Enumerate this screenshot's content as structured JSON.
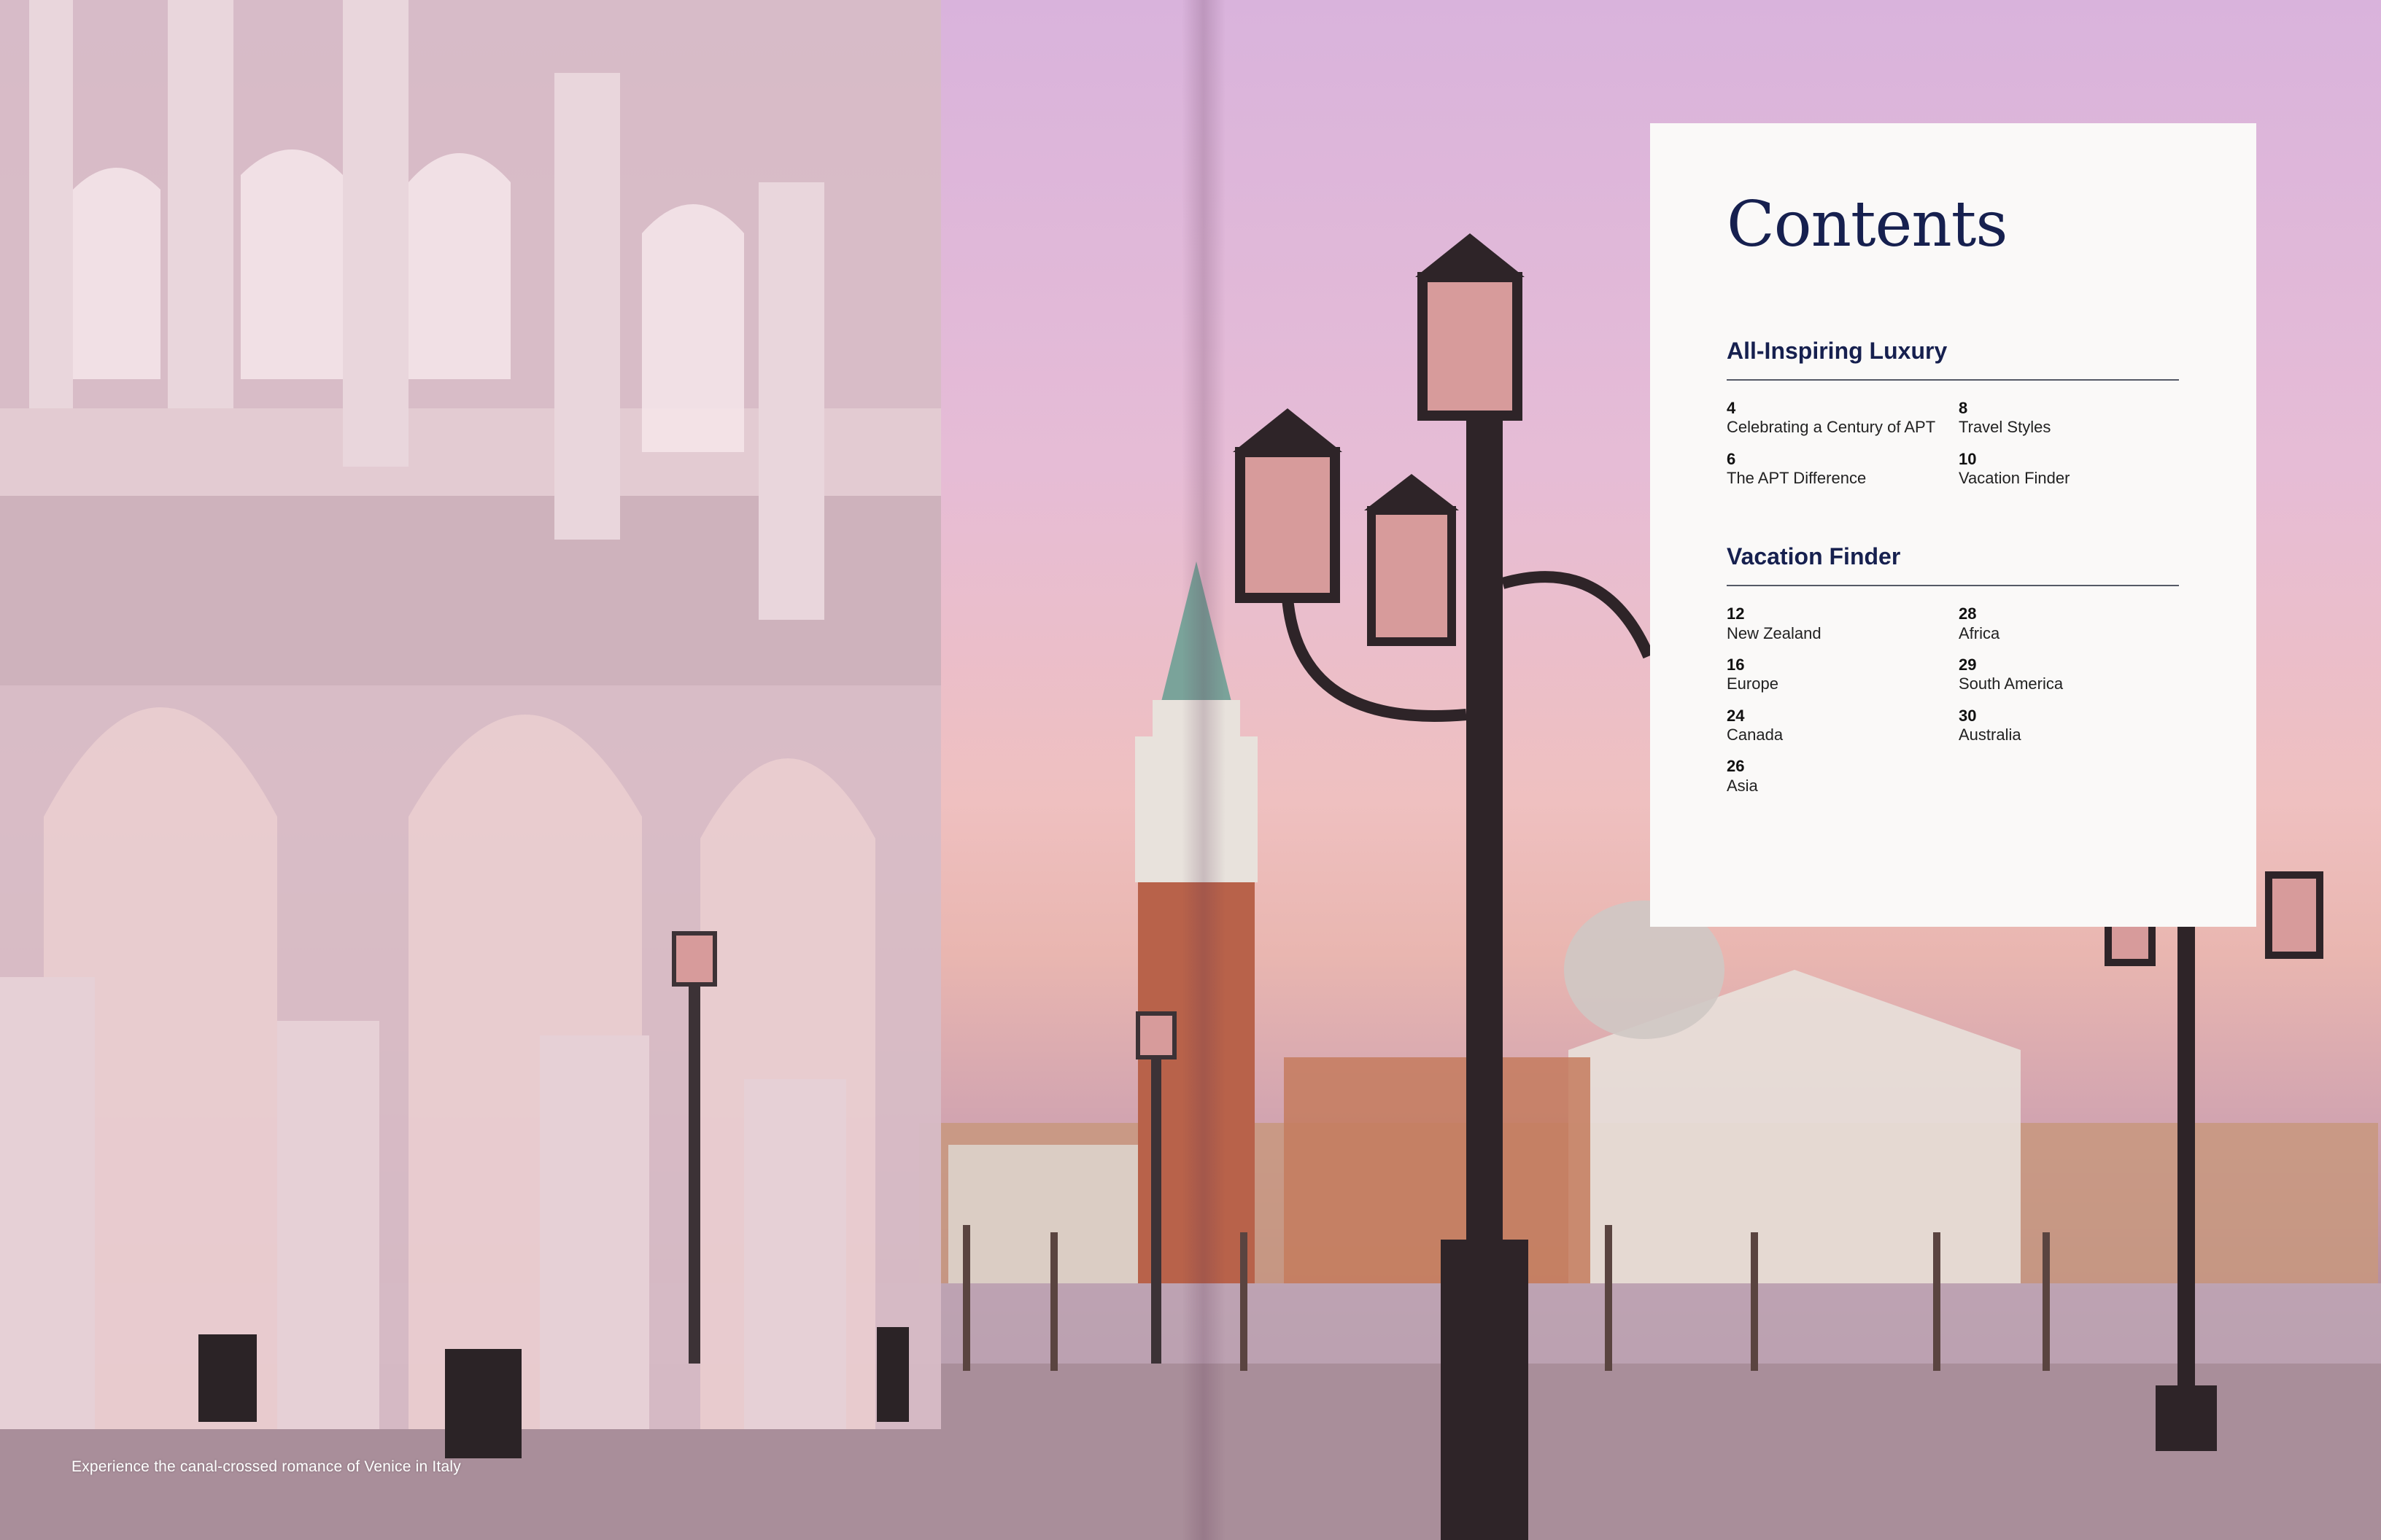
{
  "caption": "Experience the canal-crossed romance of Venice in Italy",
  "contents": {
    "title": "Contents",
    "sections": [
      {
        "heading": "All-Inspiring Luxury",
        "entries": [
          {
            "page": "4",
            "label": "Celebrating a Century of APT"
          },
          {
            "page": "8",
            "label": "Travel Styles"
          },
          {
            "page": "6",
            "label": "The APT Difference"
          },
          {
            "page": "10",
            "label": "Vacation Finder"
          }
        ]
      },
      {
        "heading": "Vacation Finder",
        "entries": [
          {
            "page": "12",
            "label": "New Zealand"
          },
          {
            "page": "28",
            "label": "Africa"
          },
          {
            "page": "16",
            "label": "Europe"
          },
          {
            "page": "29",
            "label": "South America"
          },
          {
            "page": "24",
            "label": "Canada"
          },
          {
            "page": "30",
            "label": "Australia"
          },
          {
            "page": "26",
            "label": "Asia"
          }
        ]
      }
    ]
  },
  "colors": {
    "title_navy": "#16204f",
    "panel_bg": "#faf9f8"
  }
}
